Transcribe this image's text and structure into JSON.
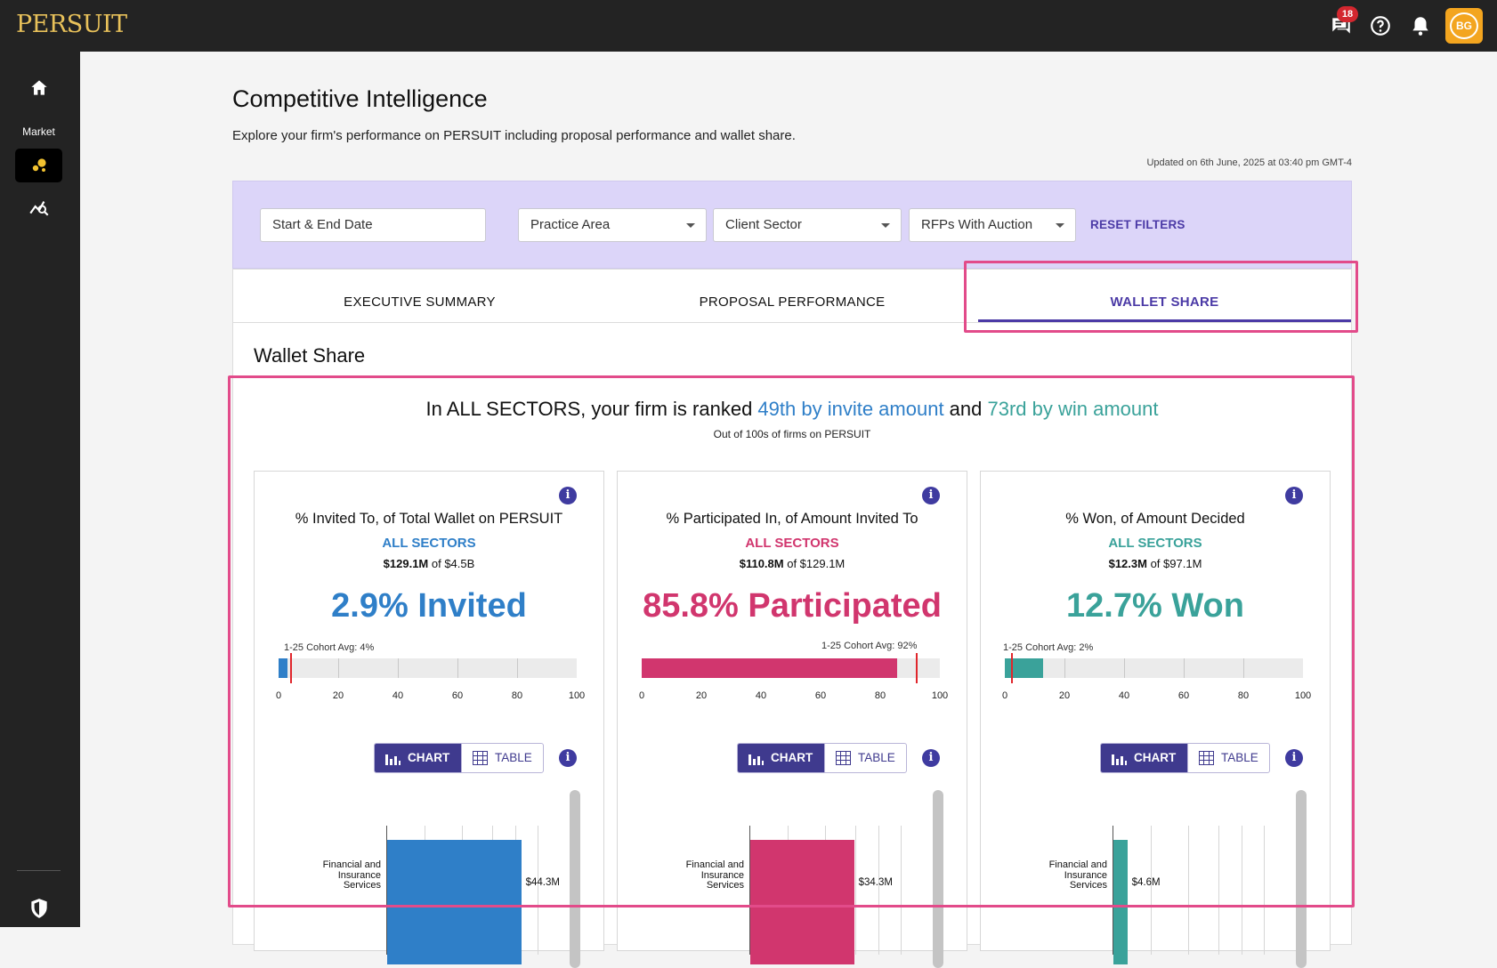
{
  "app": {
    "logo": "PERSUIT",
    "messages_badge": "18",
    "avatar_initials": "BG"
  },
  "sidebar": {
    "market_label": "Market"
  },
  "page": {
    "title": "Competitive Intelligence",
    "description": "Explore your firm's performance on PERSUIT including proposal performance and wallet share.",
    "updated": "Updated on 6th June, 2025 at 03:40 pm GMT-4"
  },
  "filters": {
    "date_placeholder": "Start & End Date",
    "practice_area": "Practice Area",
    "client_sector": "Client Sector",
    "rfps_with_auction": "RFPs With Auction",
    "reset_label": "RESET FILTERS"
  },
  "tabs": [
    {
      "label": "EXECUTIVE SUMMARY",
      "active": false
    },
    {
      "label": "PROPOSAL PERFORMANCE",
      "active": false
    },
    {
      "label": "WALLET SHARE",
      "active": true
    }
  ],
  "wallet": {
    "section_title": "Wallet Share",
    "headline_prefix": "In ALL SECTORS, your firm is ranked ",
    "headline_invite": "49th by invite amount",
    "headline_and": " and ",
    "headline_win": "73rd by win amount",
    "subhead": "Out of 100s of firms on PERSUIT"
  },
  "colors": {
    "invited": "#2f7fc8",
    "participated": "#d1366e",
    "won": "#3aa29a",
    "accent": "#4b3aa6",
    "cohort_marker": "#e0262c"
  },
  "cards": [
    {
      "title": "% Invited To, of Total Wallet on PERSUIT",
      "sector": "ALL SECTORS",
      "amount_value": "$129.1M",
      "amount_of": " of $4.5B",
      "big": "2.9% Invited",
      "percent": 2.9,
      "cohort_label": "1-25 Cohort Avg: 4%",
      "cohort_percent": 4,
      "ticks": [
        "0",
        "20",
        "40",
        "60",
        "80",
        "100"
      ],
      "chart_label": "CHART",
      "table_label": "TABLE",
      "bar_category": "Financial and Insurance Services",
      "bar_value_label": "$44.3M",
      "bar_value": 44.3
    },
    {
      "title": "% Participated In, of Amount Invited To",
      "sector": "ALL SECTORS",
      "amount_value": "$110.8M",
      "amount_of": " of $129.1M",
      "big": "85.8% Participated",
      "percent": 85.8,
      "cohort_label": "1-25 Cohort Avg: 92%",
      "cohort_percent": 92,
      "ticks": [
        "0",
        "20",
        "40",
        "60",
        "80",
        "100"
      ],
      "chart_label": "CHART",
      "table_label": "TABLE",
      "bar_category": "Financial and Insurance Services",
      "bar_value_label": "$34.3M",
      "bar_value": 34.3
    },
    {
      "title": "% Won, of Amount Decided",
      "sector": "ALL SECTORS",
      "amount_value": "$12.3M",
      "amount_of": " of $97.1M",
      "big": "12.7% Won",
      "percent": 12.7,
      "cohort_label": "1-25 Cohort Avg: 2%",
      "cohort_percent": 2,
      "ticks": [
        "0",
        "20",
        "40",
        "60",
        "80",
        "100"
      ],
      "chart_label": "CHART",
      "table_label": "TABLE",
      "bar_category": "Financial and Insurance Services",
      "bar_value_label": "$4.6M",
      "bar_value": 4.6
    }
  ]
}
